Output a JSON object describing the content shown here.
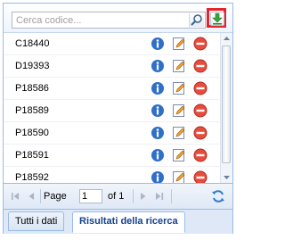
{
  "search": {
    "placeholder": "Cerca codice..."
  },
  "rows": [
    {
      "code": "C18440"
    },
    {
      "code": "D19393"
    },
    {
      "code": "P18586"
    },
    {
      "code": "P18589"
    },
    {
      "code": "P18590"
    },
    {
      "code": "P18591"
    },
    {
      "code": "P18592"
    }
  ],
  "icons": {
    "search": "magnifier-icon",
    "download": "download-arrow-icon",
    "info": "info-icon",
    "edit": "edit-pencil-icon",
    "delete": "delete-icon",
    "refresh": "refresh-icon"
  },
  "pager": {
    "page_label": "Page",
    "current_page": "1",
    "of_label": "of 1"
  },
  "tabs": [
    {
      "label": "Tutti i dati",
      "active": false
    },
    {
      "label": "Risultati della ricerca",
      "active": true
    }
  ],
  "colors": {
    "highlight": "#e3262b",
    "panel_border": "#99bbe8",
    "info_blue": "#2f6fc6",
    "delete_red": "#e74c3c",
    "download_green": "#3aa33a"
  }
}
